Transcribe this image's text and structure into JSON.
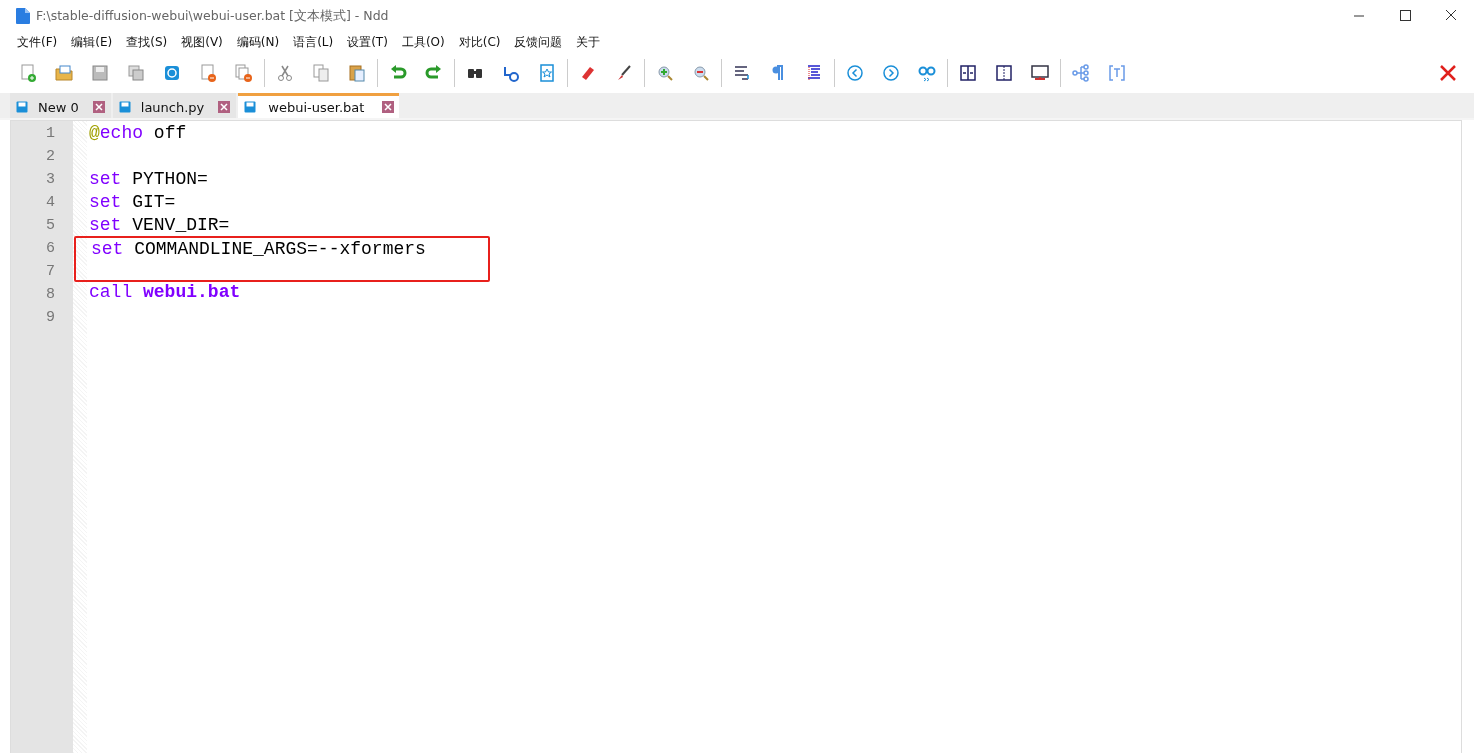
{
  "window": {
    "title": "F:\\stable-diffusion-webui\\webui-user.bat [文本模式] - Ndd"
  },
  "menu": [
    "文件(F)",
    "编辑(E)",
    "查找(S)",
    "视图(V)",
    "编码(N)",
    "语言(L)",
    "设置(T)",
    "工具(O)",
    "对比(C)",
    "反馈问题",
    "关于"
  ],
  "tabs": [
    {
      "label": "New 0",
      "selected": false
    },
    {
      "label": "launch.py",
      "selected": false
    },
    {
      "label": "webui-user.bat",
      "selected": true
    }
  ],
  "editor": {
    "lines": [
      {
        "number": "1",
        "highlighted": false,
        "tokens": [
          {
            "kind": "at",
            "text": "@"
          },
          {
            "kind": "keyword",
            "text": "echo"
          },
          {
            "kind": "plain",
            "text": " off"
          }
        ]
      },
      {
        "number": "2",
        "highlighted": false
      },
      {
        "number": "3",
        "highlighted": false,
        "tokens": [
          {
            "kind": "keyword",
            "text": "set"
          },
          {
            "kind": "plain",
            "text": " PYTHON="
          }
        ]
      },
      {
        "number": "4",
        "highlighted": false,
        "tokens": [
          {
            "kind": "keyword",
            "text": "set"
          },
          {
            "kind": "plain",
            "text": " GIT="
          }
        ]
      },
      {
        "number": "5",
        "highlighted": false,
        "tokens": [
          {
            "kind": "keyword",
            "text": "set"
          },
          {
            "kind": "plain",
            "text": " VENV_DIR="
          }
        ]
      },
      {
        "number": "6",
        "highlighted": true,
        "tokens": [
          {
            "kind": "keyword",
            "text": "set"
          },
          {
            "kind": "plain",
            "text": " COMMANDLINE_ARGS=--xformers"
          }
        ]
      },
      {
        "number": "7",
        "highlighted": true
      },
      {
        "number": "8",
        "highlighted": false,
        "tokens": [
          {
            "kind": "keyword",
            "text": "call"
          },
          {
            "kind": "label",
            "text": " webui.bat"
          }
        ]
      },
      {
        "number": "9",
        "highlighted": false
      }
    ]
  }
}
